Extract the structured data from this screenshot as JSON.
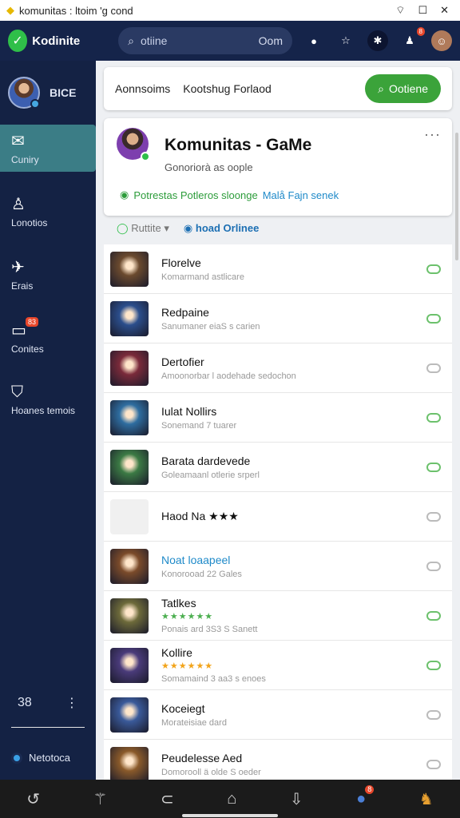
{
  "statusbar": {
    "title": "komunitas : ltoim 'g cond"
  },
  "appbar": {
    "logo_text": "Kodinite",
    "search_placeholder": "otiine",
    "search_right": "Oom"
  },
  "sidebar": {
    "user_name": "BICE",
    "items": [
      {
        "label": "Cuniry",
        "icon": "chat-icon",
        "active": true
      },
      {
        "label": "Lonotios",
        "icon": "people-icon"
      },
      {
        "label": "Erais",
        "icon": "leaf-icon"
      },
      {
        "label": "Conites",
        "icon": "monitor-icon",
        "badge": "83"
      },
      {
        "label": "Hoanes temois",
        "icon": "shield-icon"
      }
    ],
    "bottom_label": "38",
    "network_label": "Netotoca"
  },
  "header": {
    "tab1": "Aonnsoims",
    "tab2": "Kootshug Forlaod",
    "button": "Ootiene"
  },
  "community": {
    "title": "Komunitas - GaMe",
    "subtitle": "Gonoriorà as oople",
    "status": "Potrestas Potleros sloonge",
    "status_link": "Malå Fajn senek"
  },
  "filters": {
    "f1": "Ruttite",
    "f2": "hoad Orlinee"
  },
  "list": [
    {
      "title": "Florelve",
      "sub": "Komarmand astlicare",
      "on": true,
      "color": "#6b4a2e"
    },
    {
      "title": "Redpaine",
      "sub": "Sanumaner eiaS s carien",
      "on": true,
      "color": "#2b4e8c"
    },
    {
      "title": "Dertofier",
      "sub": "Amoonorbar l aodehade sedochon",
      "on": false,
      "color": "#7a2a3a"
    },
    {
      "title": "Iulat Nollirs",
      "sub": "Sonemand 7 tuarer",
      "on": true,
      "color": "#2e6da0"
    },
    {
      "title": "Barata dardevede",
      "sub": "Goleamaanl otlerie srperl",
      "on": true,
      "color": "#3b7a44"
    },
    {
      "title": "Haod Na ★★★",
      "sub": "",
      "on": false,
      "color": "#e8e8e8"
    },
    {
      "title": "Noat loaapeel",
      "sub": "Konorooad 22 Gales",
      "on": false,
      "color": "#7b4b2a",
      "blue": true
    },
    {
      "title": "Tatlkes",
      "sub": "Ponais ard 3S3 S Sanett",
      "on": true,
      "color": "#6d6a3a",
      "stars": "★★★★★★"
    },
    {
      "title": "Kollire",
      "sub": "Somamaind 3 aa3 s enoes",
      "on": true,
      "color": "#4a3b7a",
      "stars": "★★★★★★",
      "gold": true
    },
    {
      "title": "Koceiegt",
      "sub": "Morateisiae dard",
      "on": false,
      "color": "#3a5a9a"
    },
    {
      "title": "Peudelesse Aed",
      "sub": "Domorooll ä olde S oeder",
      "on": false,
      "color": "#8a5a2a"
    }
  ]
}
